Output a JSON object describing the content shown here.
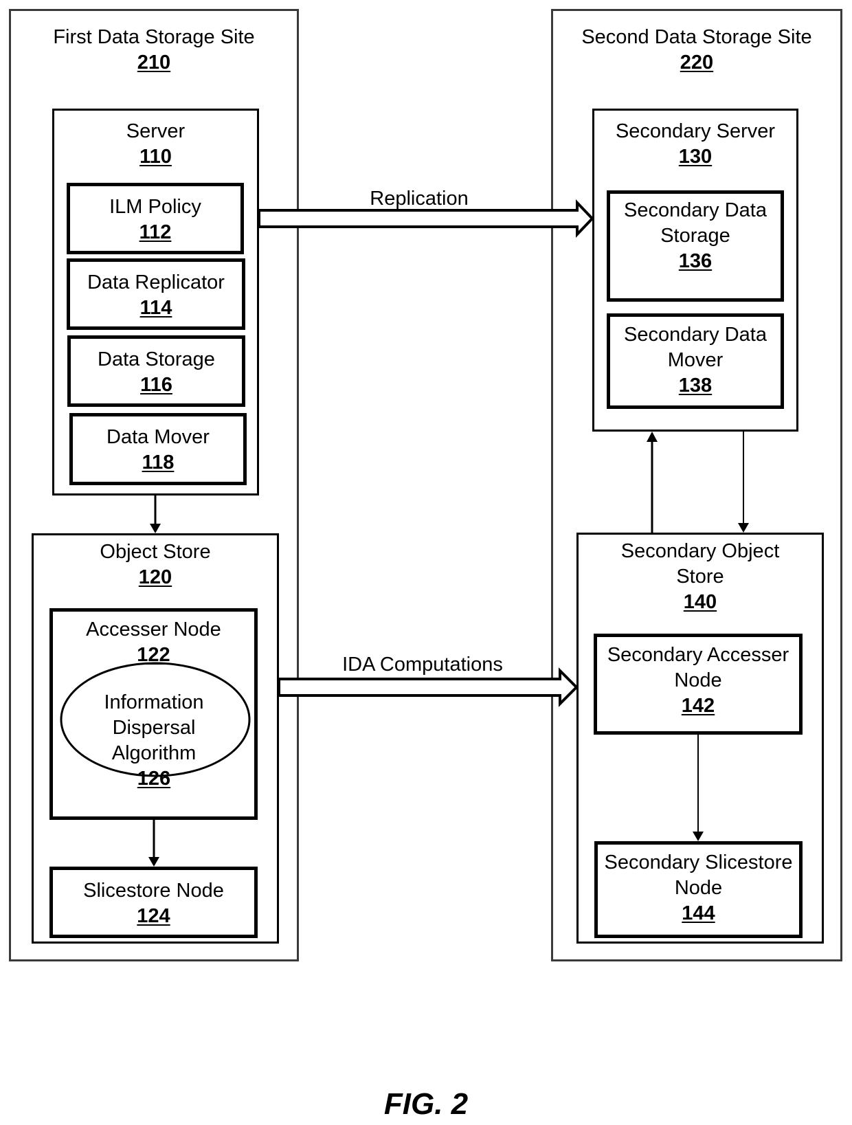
{
  "figure": {
    "caption": "FIG. 2"
  },
  "sites": {
    "first": {
      "name": "First Data Storage Site",
      "ref": "210"
    },
    "second": {
      "name": "Second Data Storage Site",
      "ref": "220"
    }
  },
  "components": {
    "server": {
      "name": "Server",
      "ref": "110"
    },
    "ilm_policy": {
      "name": "ILM Policy",
      "ref": "112"
    },
    "data_replicator": {
      "name": "Data Replicator",
      "ref": "114"
    },
    "data_storage": {
      "name": "Data Storage",
      "ref": "116"
    },
    "data_mover": {
      "name": "Data Mover",
      "ref": "118"
    },
    "object_store": {
      "name": "Object Store",
      "ref": "120"
    },
    "accesser_node": {
      "name": "Accesser Node",
      "ref": "122"
    },
    "ida": {
      "lines": [
        "Information",
        "Dispersal",
        "Algorithm"
      ],
      "ref": "126"
    },
    "slicestore_node": {
      "name": "Slicestore Node",
      "ref": "124"
    },
    "secondary_server": {
      "name": "Secondary Server",
      "ref": "130"
    },
    "secondary_data_storage": {
      "lines": [
        "Secondary Data",
        "Storage"
      ],
      "ref": "136"
    },
    "secondary_data_mover": {
      "lines": [
        "Secondary Data",
        "Mover"
      ],
      "ref": "138"
    },
    "secondary_object_store": {
      "lines": [
        "Secondary Object",
        "Store"
      ],
      "ref": "140"
    },
    "secondary_accesser_node": {
      "lines": [
        "Secondary Accesser",
        "Node"
      ],
      "ref": "142"
    },
    "secondary_slicestore_node": {
      "lines": [
        "Secondary Slicestore",
        "Node"
      ],
      "ref": "144"
    }
  },
  "arrows": {
    "replication": {
      "label": "Replication",
      "from": "Server 110",
      "to": "Secondary Server 130"
    },
    "ida_computations": {
      "label": "IDA Computations",
      "from": "Object Store 120",
      "to": "Secondary Object Store 140"
    },
    "server_to_object_store": {
      "from": "Server 110",
      "to": "Object Store 120"
    },
    "accesser_to_slicestore": {
      "from": "Accesser Node 122",
      "to": "Slicestore Node 124"
    },
    "sec_object_store_to_sec_server": {
      "from": "Secondary Object Store 140",
      "to": "Secondary Server 130"
    },
    "sec_server_to_sec_object_store": {
      "from": "Secondary Server 130",
      "to": "Secondary Object Store 140"
    },
    "sec_accesser_to_sec_slicestore": {
      "from": "Secondary Accesser Node 142",
      "to": "Secondary Slicestore Node 144"
    }
  }
}
